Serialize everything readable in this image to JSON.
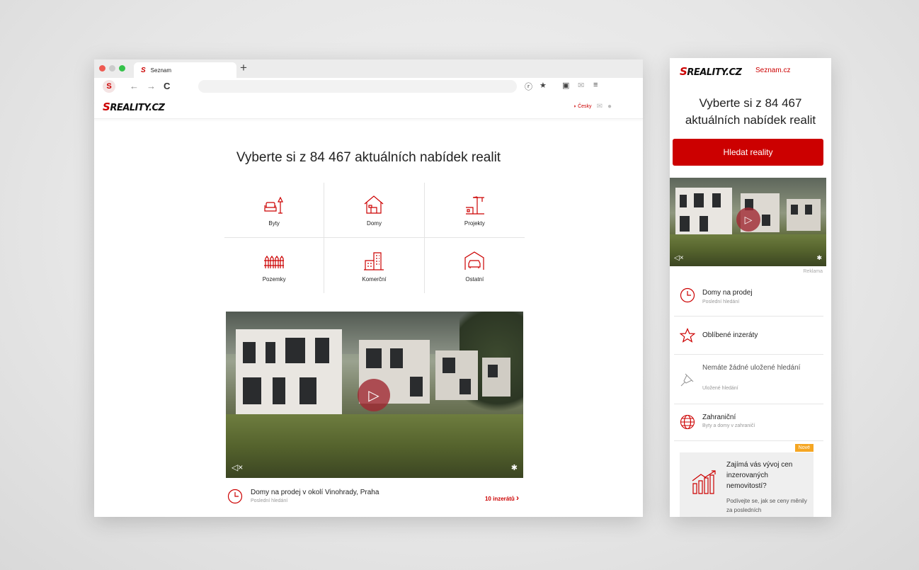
{
  "desktop": {
    "tab_label": "Seznam",
    "tab_logo": "S",
    "new_tab": "+",
    "site_logo_s": "S",
    "site_logo_rest": "REALITY.CZ",
    "language": "Česky",
    "headline": "Vyberte si z  84 467  aktuálních nabídek realit",
    "categories": [
      {
        "label": "Byty",
        "icon": "sofa-lamp-icon"
      },
      {
        "label": "Domy",
        "icon": "house-icon"
      },
      {
        "label": "Projekty",
        "icon": "crane-icon"
      },
      {
        "label": "Pozemky",
        "icon": "fence-icon"
      },
      {
        "label": "Komerční",
        "icon": "office-building-icon"
      },
      {
        "label": "Ostatní",
        "icon": "garage-car-icon"
      }
    ],
    "recent_search": {
      "title": "Domy na prodej v okolí Vinohrady, Praha",
      "subtitle": "Poslední hledání",
      "count": "10 inzerátů"
    }
  },
  "mobile": {
    "logo_s": "S",
    "logo_rest": "REALITY.CZ",
    "seznam_link": "Seznam.cz",
    "headline_line1": "Vyberte si z  84 467",
    "headline_line2": "aktuálních nabídek realit",
    "search_button": "Hledat reality",
    "ad_label": "Reklama",
    "items": [
      {
        "title": "Domy na prodej",
        "subtitle": "Poslední hledání",
        "icon": "clock-icon"
      },
      {
        "title": "Oblíbené inzeráty",
        "subtitle": "",
        "icon": "star-icon"
      },
      {
        "title": "Nemáte žádné uložené hledání",
        "subtitle": "Uložené hledání",
        "icon": "pin-icon"
      },
      {
        "title": "Zahraniční",
        "subtitle": "Byty a domy v zahraničí",
        "icon": "globe-icon"
      }
    ],
    "promo": {
      "badge": "Nové",
      "title": "Zajímá vás vývoj cen inzerovaných nemovitostí?",
      "subtitle": "Podívejte se, jak se ceny měnily za posledních"
    }
  },
  "colors": {
    "brand_red": "#cc0000",
    "badge_orange": "#f5a623"
  }
}
